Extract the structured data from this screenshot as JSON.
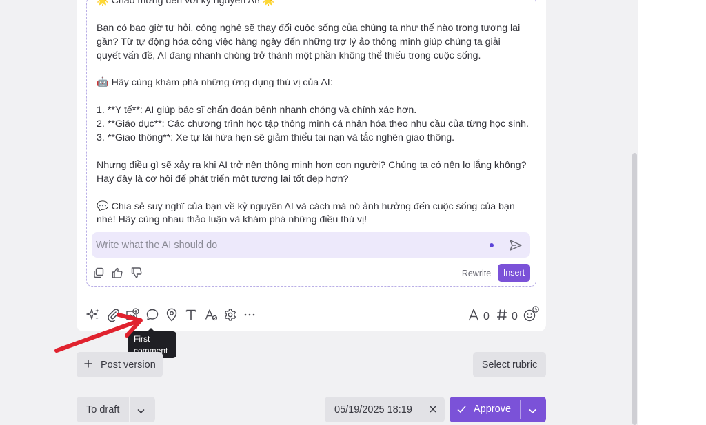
{
  "ai_panel": {
    "lines": [
      "🌟 Chào mừng đến với kỷ nguyên AI! 🌟",
      "",
      "Bạn có bao giờ tự hỏi, công nghệ sẽ thay đổi cuộc sống của chúng ta như thế nào trong tương lai",
      "gần? Từ tự động hóa công việc hàng ngày đến những trợ lý ảo thông minh giúp chúng ta giải",
      "quyết vấn đề, AI đang nhanh chóng trở thành một phần không thể thiếu trong cuộc sống.",
      "",
      "🤖 Hãy cùng khám phá những ứng dụng thú vị của AI:",
      "",
      "1. **Y tế**: AI giúp bác sĩ chẩn đoán bệnh nhanh chóng và chính xác hơn.",
      "2. **Giáo dục**: Các chương trình học tập thông minh cá nhân hóa theo nhu cầu của từng học sinh.",
      "3. **Giao thông**: Xe tự lái hứa hẹn sẽ giảm thiểu tai nạn và tắc nghẽn giao thông.",
      "",
      "Nhưng điều gì sẽ xảy ra khi AI trở nên thông minh hơn con người? Chúng ta có nên lo lắng không?",
      "Hay đây là cơ hội để phát triển một tương lai tốt đẹp hơn?",
      "",
      "💬 Chia sẻ suy nghĩ của bạn về kỷ nguyên AI và cách mà nó ảnh hưởng đến cuộc sống của bạn",
      "nhé! Hãy cùng nhau thảo luận và khám phá những điều thú vị!"
    ],
    "prompt_placeholder": "Write what the AI should do",
    "rewrite_label": "Rewrite",
    "insert_label": "Insert"
  },
  "toolbar": {
    "icons": [
      "sparkle-icon",
      "paperclip-icon",
      "image-add-icon",
      "comment-icon",
      "location-pin-icon",
      "text-icon",
      "font-style-icon",
      "settings-icon",
      "more-icon"
    ],
    "char_count": "0",
    "hashtag_count": "0"
  },
  "tooltip": {
    "line1": "First",
    "line2": "comment"
  },
  "actions": {
    "post_version": "Post version",
    "select_rubric": "Select rubric",
    "to_draft": "To draft",
    "date_value": "05/19/2025 18:19",
    "approve": "Approve"
  },
  "colors": {
    "accent": "#7b52d8",
    "prompt_bg": "#ede9fb",
    "arrow": "#e0222e"
  }
}
